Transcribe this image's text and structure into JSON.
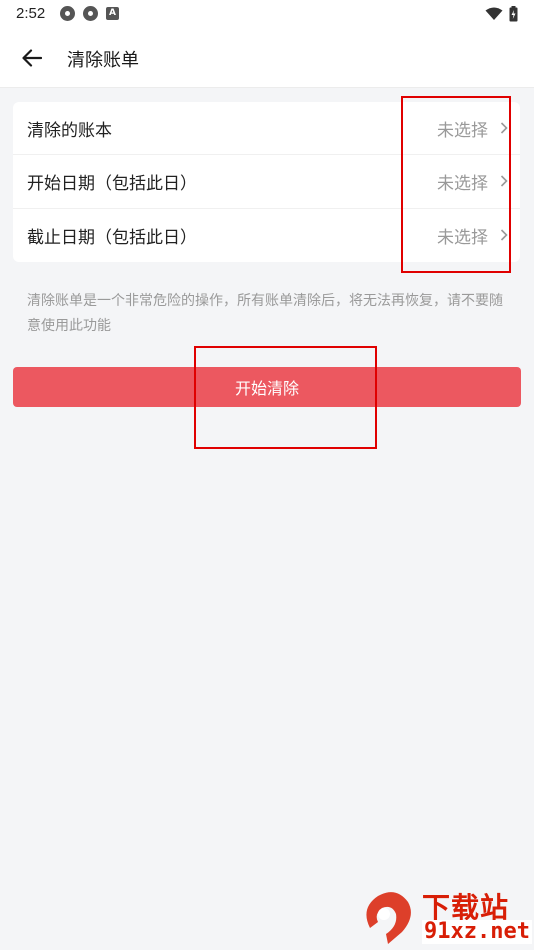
{
  "status_bar": {
    "time": "2:52",
    "icons_left": [
      "settings-icon",
      "settings-icon",
      "a-icon"
    ],
    "icons_right": [
      "wifi-icon",
      "battery-icon"
    ],
    "a_icon_letter": "A"
  },
  "app_bar": {
    "back_icon": "arrow-left-icon",
    "title": "清除账单"
  },
  "settings": {
    "rows": [
      {
        "label": "清除的账本",
        "value": "未选择"
      },
      {
        "label": "开始日期（包括此日）",
        "value": "未选择"
      },
      {
        "label": "截止日期（包括此日）",
        "value": "未选择"
      }
    ]
  },
  "note": "清除账单是一个非常危险的操作，所有账单清除后，将无法再恢复，请不要随意使用此功能",
  "action": {
    "start_label": "开始清除"
  },
  "watermark": {
    "top_text": "下载站",
    "bottom_text": "91xz.net"
  },
  "colors": {
    "accent": "#ec5860",
    "highlight": "#e00000",
    "background": "#f4f5f7",
    "watermark": "#d81e06"
  }
}
